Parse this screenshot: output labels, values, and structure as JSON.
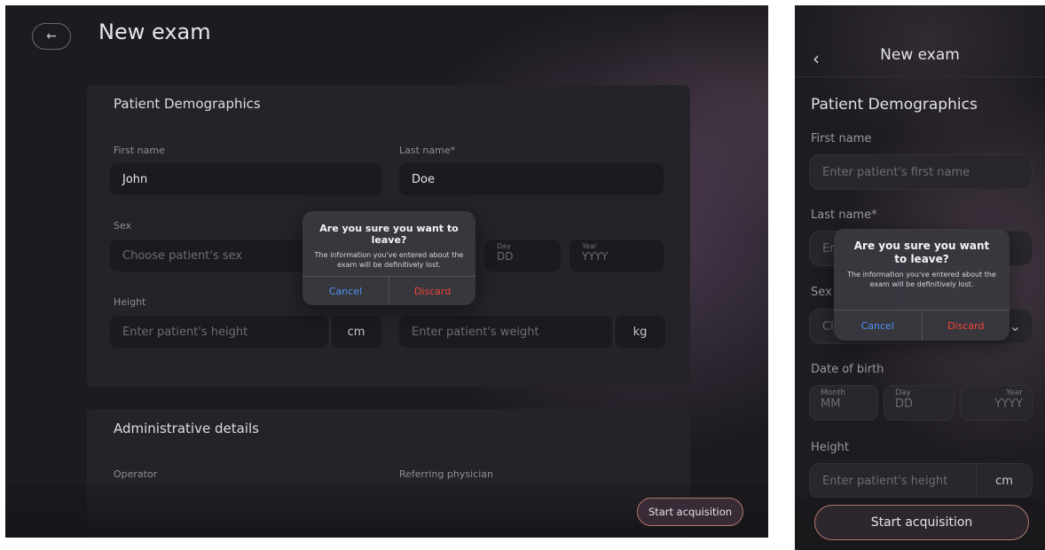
{
  "tablet": {
    "title": "New exam",
    "patient_section": {
      "title": "Patient Demographics",
      "first_name": {
        "label": "First name",
        "value": "John"
      },
      "last_name": {
        "label": "Last name*",
        "value": "Doe"
      },
      "sex": {
        "label": "Sex",
        "placeholder": "Choose patient's sex"
      },
      "dob": {
        "day_label": "Day",
        "day_placeholder": "DD",
        "year_label": "Year",
        "year_placeholder": "YYYY"
      },
      "height": {
        "label": "Height",
        "placeholder": "Enter patient's height",
        "unit": "cm"
      },
      "weight": {
        "placeholder": "Enter patient's weight",
        "unit": "kg"
      }
    },
    "admin_section": {
      "title": "Administrative details",
      "operator_label": "Operator",
      "referring_label": "Referring physician"
    },
    "start_button": "Start acquisition",
    "alert": {
      "title": "Are you sure you want to leave?",
      "message": "The information you've entered about the exam will be definitively lost.",
      "cancel": "Cancel",
      "discard": "Discard"
    }
  },
  "phone": {
    "back_icon": "chevron-left-icon",
    "title": "New exam",
    "section_title": "Patient Demographics",
    "first_name": {
      "label": "First name",
      "placeholder": "Enter patient's first name"
    },
    "last_name": {
      "label": "Last name*",
      "placeholder_fragment": "Er"
    },
    "sex": {
      "label": "Sex",
      "placeholder_fragment": "Cl"
    },
    "dob": {
      "label": "Date of birth",
      "month_label": "Month",
      "month_placeholder": "MM",
      "day_label": "Day",
      "day_placeholder": "DD",
      "year_label": "Year",
      "year_placeholder": "YYYY"
    },
    "height": {
      "label": "Height",
      "placeholder": "Enter patient's height",
      "unit": "cm"
    },
    "start_button": "Start acquisition",
    "alert": {
      "title": "Are you sure you want to leave?",
      "message": "The information you've entered about the exam will be definitively lost.",
      "cancel": "Cancel",
      "discard": "Discard"
    }
  },
  "colors": {
    "background": "#1d1b20",
    "card": "#252327",
    "field": "#1b1a1e",
    "cancel": "#4a90f2",
    "discard": "#f04438",
    "accent_border": "#b07a6a"
  }
}
